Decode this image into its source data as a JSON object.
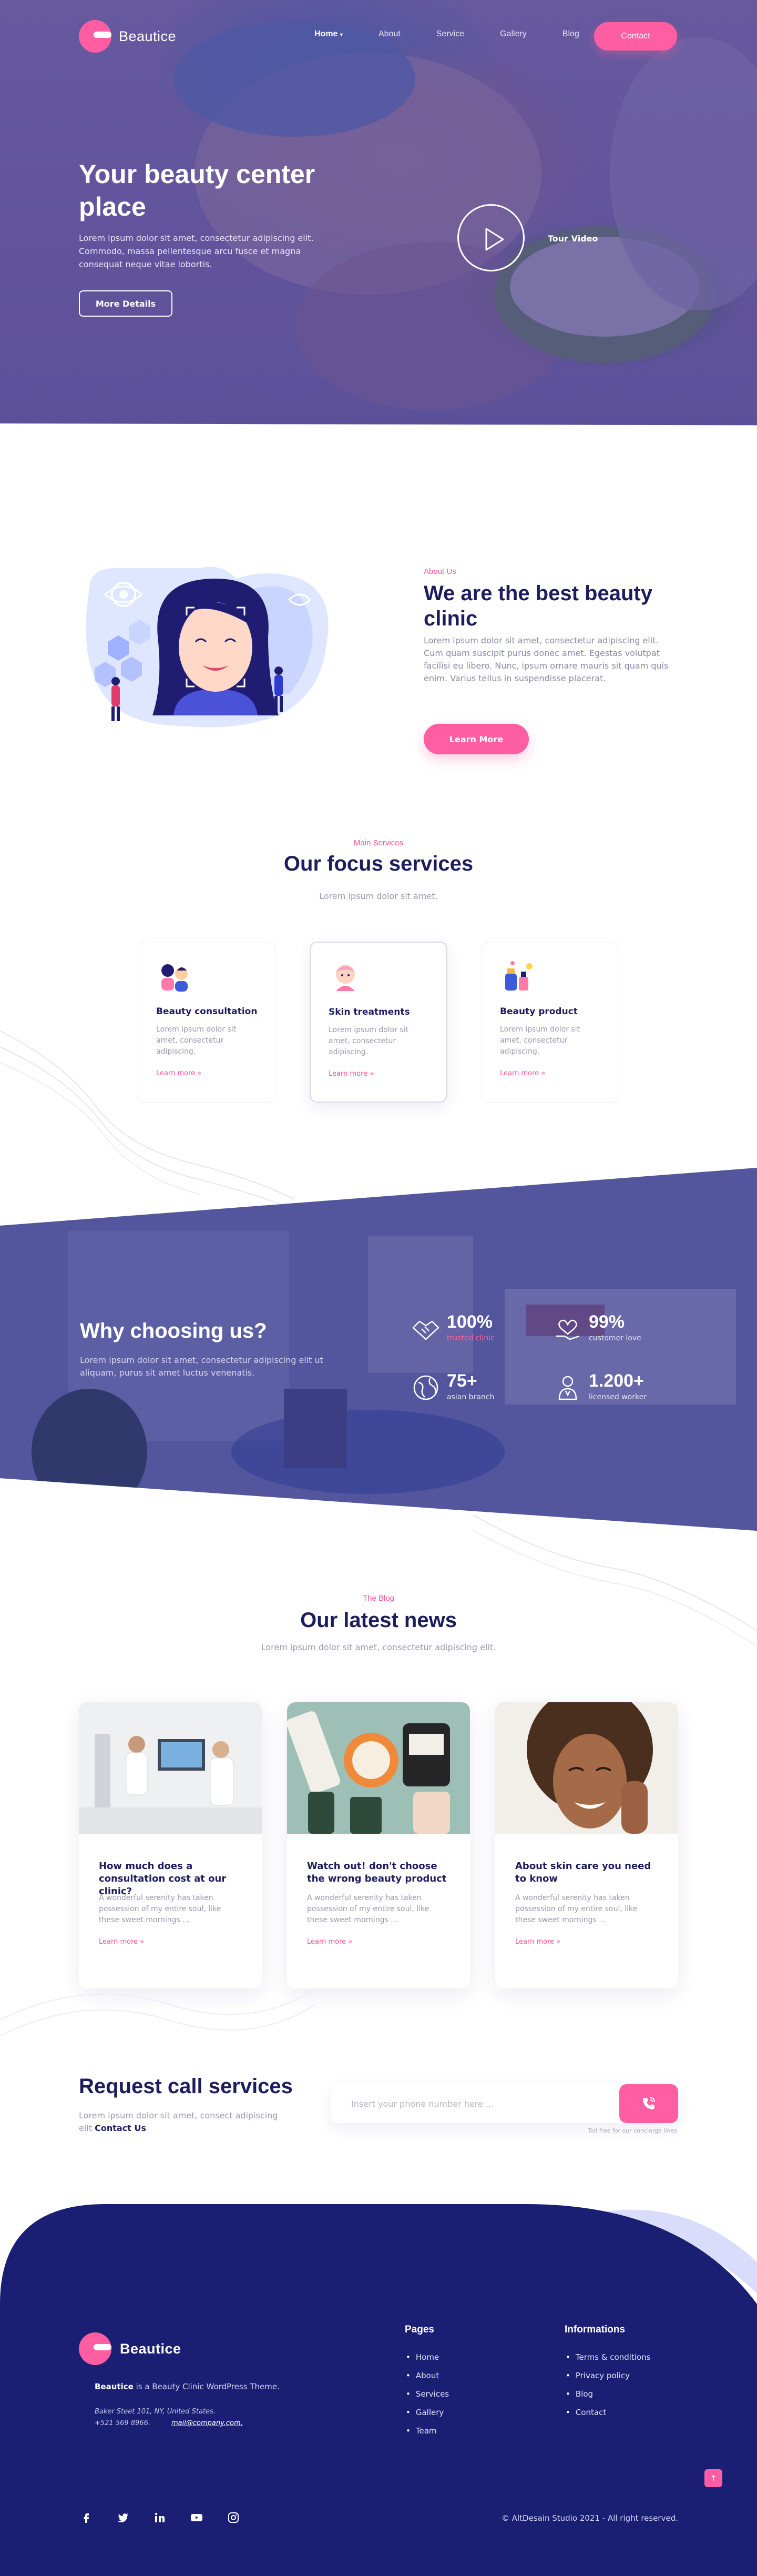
{
  "brand": {
    "name": "Beautice",
    "accent": "#ff5fa2",
    "navy": "#1d1d5e",
    "footer_bg": "#1a1f74"
  },
  "nav": {
    "items": [
      {
        "label": "Home",
        "suffix": "▾"
      },
      {
        "label": "About"
      },
      {
        "label": "Service"
      },
      {
        "label": "Gallery"
      },
      {
        "label": "Blog"
      }
    ],
    "contact_label": "Contact"
  },
  "hero": {
    "title": "Your beauty center place",
    "text": "Lorem ipsum dolor sit amet, consectetur adipiscing elit. Commodo, massa pellentesque arcu fusce et magna consequat neque vitae lobortis.",
    "button_label": "More Details",
    "video_label": "Tour Video"
  },
  "about": {
    "tag": "About Us",
    "title": "We are the best beauty clinic",
    "text": "Lorem ipsum dolor sit amet, consectetur adipiscing elit. Cum quam suscipit purus donec amet. Egestas volutpat facilisi eu libero. Nunc, ipsum ornare mauris sit quam quis enim. Varius tellus in suspendisse placerat.",
    "button_label": "Learn More"
  },
  "services": {
    "tag": "Main Services",
    "title": "Our focus services",
    "subtitle": "Lorem ipsum dolor sit amet.",
    "cards": [
      {
        "icon": "consultation-icon",
        "title": "Beauty consultation",
        "text": "Lorem ipsum dolor sit amet, consectetur adipiscing.",
        "link": "Learn more"
      },
      {
        "icon": "skin-treatment-icon",
        "title": "Skin treatments",
        "text": "Lorem ipsum dolor sit amet, consectetur adipiscing.",
        "link": "Learn more"
      },
      {
        "icon": "beauty-product-icon",
        "title": "Beauty product",
        "text": "Lorem ipsum dolor sit amet, consectetur adipiscing.",
        "link": "Learn more"
      }
    ]
  },
  "why": {
    "title": "Why choosing us?",
    "text": "Lorem ipsum dolor sit amet, consectetur adipiscing elit ut aliquam, purus sit amet luctus venenatis.",
    "stats": [
      {
        "icon": "handshake-icon",
        "value": "100%",
        "label": "trusted clinic"
      },
      {
        "icon": "heart-hand-icon",
        "value": "99%",
        "label": "customer love"
      },
      {
        "icon": "globe-icon",
        "value": "75+",
        "label": "asian branch"
      },
      {
        "icon": "worker-icon",
        "value": "1.200+",
        "label": "licensed worker"
      }
    ]
  },
  "blog": {
    "tag": "The Blog",
    "title": "Our latest news",
    "subtitle": "Lorem ipsum dolor sit amet, consectetur adipiscing elit.",
    "posts": [
      {
        "title": "How much does a consultation cost at our clinic?",
        "text": "A wonderful serenity has taken possession of my entire soul, like these sweet mornings ...",
        "link": "Learn more"
      },
      {
        "title": "Watch out! don't choose the wrong beauty product",
        "text": "A wonderful serenity has taken possession of my entire soul, like these sweet mornings ...",
        "link": "Learn more"
      },
      {
        "title": "About skin care you need to know",
        "text": "A wonderful serenity has taken possession of my entire soul, like these sweet mornings ...",
        "link": "Learn more"
      }
    ]
  },
  "call": {
    "title": "Request call services",
    "text": "Lorem ipsum dolor sit amet, consect adipiscing elit",
    "text_link": "Contact Us",
    "placeholder": "Insert your phone number here ...",
    "note": "Toll free for our concierge lines"
  },
  "footer": {
    "brand_name": "Beautice",
    "desc_rest": "is a Beauty Clinic WordPress Theme.",
    "address": "Baker Steet 101, NY, United States.",
    "phone": "+521 569 8966.",
    "email": "mail@company.com.",
    "pages_title": "Pages",
    "pages": [
      "Home",
      "About",
      "Services",
      "Gallery",
      "Team"
    ],
    "info_title": "Informations",
    "info": [
      "Terms & conditions",
      "Privacy policy",
      "Blog",
      "Contact"
    ],
    "social_icons": [
      "facebook-icon",
      "twitter-icon",
      "linkedin-icon",
      "youtube-icon",
      "instagram-icon"
    ],
    "copyright": "© AltDesain Studio 2021 - All right reserved."
  }
}
